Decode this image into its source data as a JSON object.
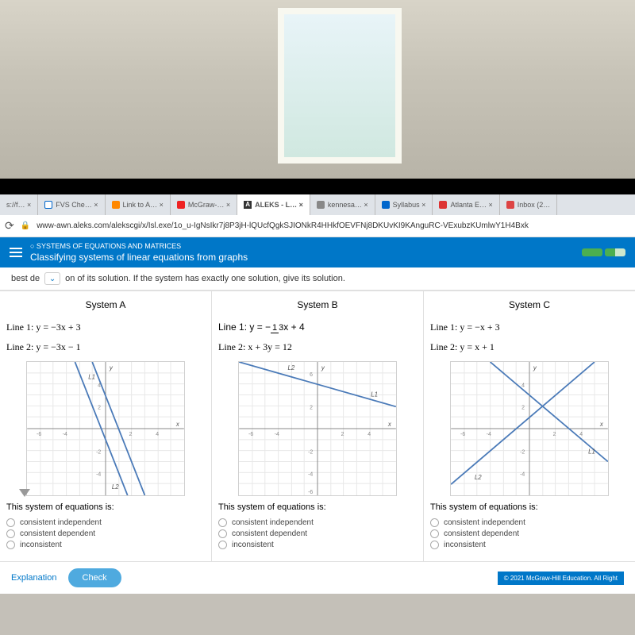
{
  "tabs": {
    "t0": "s://f… ×",
    "t1": "FVS Che… ×",
    "t2": "Link to A… ×",
    "t3": "McGraw-… ×",
    "t4": "ALEKS - L… ×",
    "t5": "kennesa… ×",
    "t6": "Syllabus ×",
    "t7": "Atlanta E… ×",
    "t8": "Inbox (2…"
  },
  "url": "www-awn.aleks.com/alekscgi/x/Isl.exe/1o_u-IgNsIkr7j8P3jH-lQUcfQgkSJIONkR4HHkfOEVFNj8DKUvKI9KAnguRC-VExubzKUmlwY1H4Bxk",
  "header": {
    "topic": "○ SYSTEMS OF EQUATIONS AND MATRICES",
    "title": "Classifying systems of linear equations from graphs"
  },
  "instruction": {
    "pre": "best de",
    "post": "on of its solution. If the system has exactly one solution, give its solution."
  },
  "systems": {
    "a": {
      "title": "System A",
      "line1": "Line 1: y = −3x + 3",
      "line2": "Line 2: y = −3x − 1",
      "question": "This system of equations is:",
      "opt1": "consistent independent",
      "opt2": "consistent dependent",
      "opt3": "inconsistent",
      "l1": "L1",
      "l2": "L2"
    },
    "b": {
      "title": "System B",
      "line1_pre": "Line 1: y = −",
      "line1_num": "1",
      "line1_den": "3",
      "line1_post": "x + 4",
      "line2": "Line 2: x + 3y = 12",
      "question": "This system of equations is:",
      "opt1": "consistent independent",
      "opt2": "consistent dependent",
      "opt3": "inconsistent",
      "l1": "L1",
      "l2": "L2"
    },
    "c": {
      "title": "System C",
      "line1": "Line 1: y = −x + 3",
      "line2": "Line 2: y = x + 1",
      "question": "This system of equations is:",
      "opt1": "consistent independent",
      "opt2": "consistent dependent",
      "opt3": "inconsistent",
      "l1": "L1",
      "l2": "L2"
    }
  },
  "chart_data": [
    {
      "type": "line",
      "title": "System A",
      "xlim": [
        -6,
        6
      ],
      "ylim": [
        -6,
        6
      ],
      "series": [
        {
          "name": "L1",
          "equation": "y=-3x+3",
          "points": [
            [
              -1,
              6
            ],
            [
              3,
              -6
            ]
          ]
        },
        {
          "name": "L2",
          "equation": "y=-3x-1",
          "points": [
            [
              -2.33,
              6
            ],
            [
              1.67,
              -6
            ]
          ]
        }
      ]
    },
    {
      "type": "line",
      "title": "System B",
      "xlim": [
        -6,
        6
      ],
      "ylim": [
        -6,
        6
      ],
      "series": [
        {
          "name": "L1",
          "equation": "y=-(1/3)x+4",
          "points": [
            [
              -6,
              6
            ],
            [
              6,
              2
            ]
          ]
        },
        {
          "name": "L2",
          "equation": "x+3y=12",
          "points": [
            [
              -6,
              6
            ],
            [
              6,
              2
            ]
          ]
        }
      ]
    },
    {
      "type": "line",
      "title": "System C",
      "xlim": [
        -6,
        6
      ],
      "ylim": [
        -6,
        6
      ],
      "series": [
        {
          "name": "L1",
          "equation": "y=-x+3",
          "points": [
            [
              -3,
              6
            ],
            [
              6,
              -3
            ]
          ]
        },
        {
          "name": "L2",
          "equation": "y=x+1",
          "points": [
            [
              -6,
              -5
            ],
            [
              5,
              6
            ]
          ]
        }
      ]
    }
  ],
  "footer": {
    "explanation": "Explanation",
    "check": "Check",
    "copyright": "© 2021 McGraw-Hill Education. All Right"
  },
  "axis": {
    "x": "x",
    "y": "y",
    "t2": "2",
    "t4": "4",
    "t6": "6",
    "tm2": "-2",
    "tm4": "-4",
    "tm6": "-6"
  }
}
